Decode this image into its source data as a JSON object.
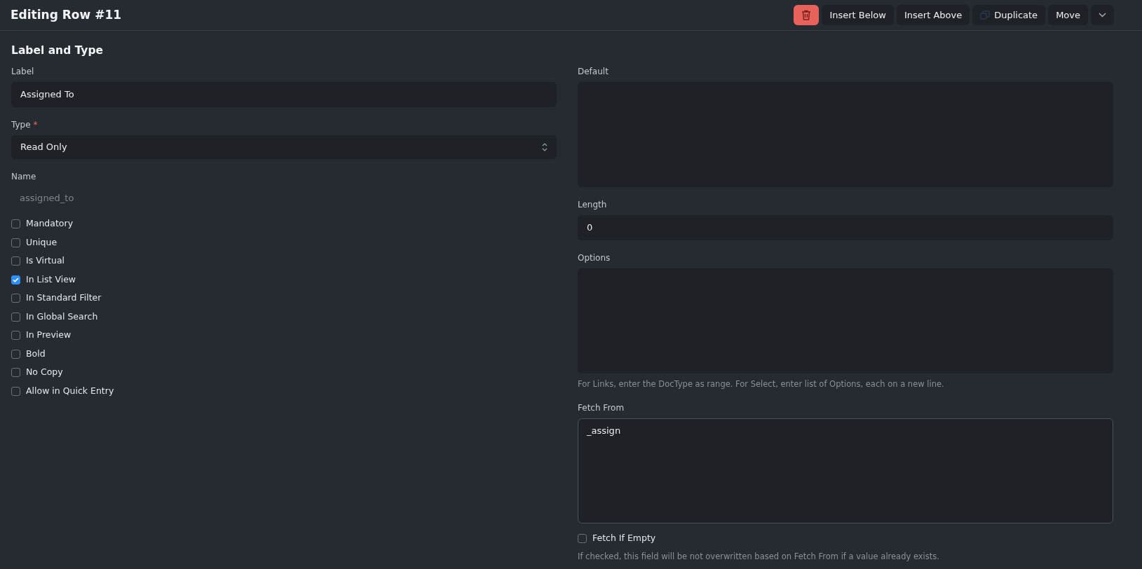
{
  "header": {
    "title": "Editing Row #11",
    "buttons": [
      {
        "kind": "delete"
      },
      {
        "kind": "text",
        "label": "Insert Below"
      },
      {
        "kind": "text",
        "label": "Insert Above"
      },
      {
        "kind": "duplicate",
        "label": "Duplicate"
      },
      {
        "kind": "text",
        "label": "Move"
      },
      {
        "kind": "collapse"
      }
    ]
  },
  "section": {
    "title": "Label and Type"
  },
  "left": {
    "label_field": {
      "label": "Label",
      "value": "Assigned To"
    },
    "type_field": {
      "label": "Type",
      "required_mark": "*",
      "value": "Read Only"
    },
    "name_field": {
      "label": "Name",
      "value": "assigned_to"
    },
    "checkboxes": [
      {
        "label": "Mandatory",
        "checked": false
      },
      {
        "label": "Unique",
        "checked": false
      },
      {
        "label": "Is Virtual",
        "checked": false
      },
      {
        "label": "In List View",
        "checked": true
      },
      {
        "label": "In Standard Filter",
        "checked": false
      },
      {
        "label": "In Global Search",
        "checked": false
      },
      {
        "label": "In Preview",
        "checked": false
      },
      {
        "label": "Bold",
        "checked": false
      },
      {
        "label": "No Copy",
        "checked": false
      },
      {
        "label": "Allow in Quick Entry",
        "checked": false
      }
    ]
  },
  "right": {
    "default_field": {
      "label": "Default"
    },
    "length_field": {
      "label": "Length",
      "value": "0"
    },
    "options_field": {
      "label": "Options",
      "help": "For Links, enter the DocType as range. For Select, enter list of Options, each on a new line."
    },
    "fetch_from_field": {
      "label": "Fetch From",
      "value": "_assign"
    },
    "fetch_if_empty": {
      "label": "Fetch If Empty",
      "checked": false,
      "help": "If checked, this field will be not overwritten based on Fetch From if a value already exists."
    }
  }
}
